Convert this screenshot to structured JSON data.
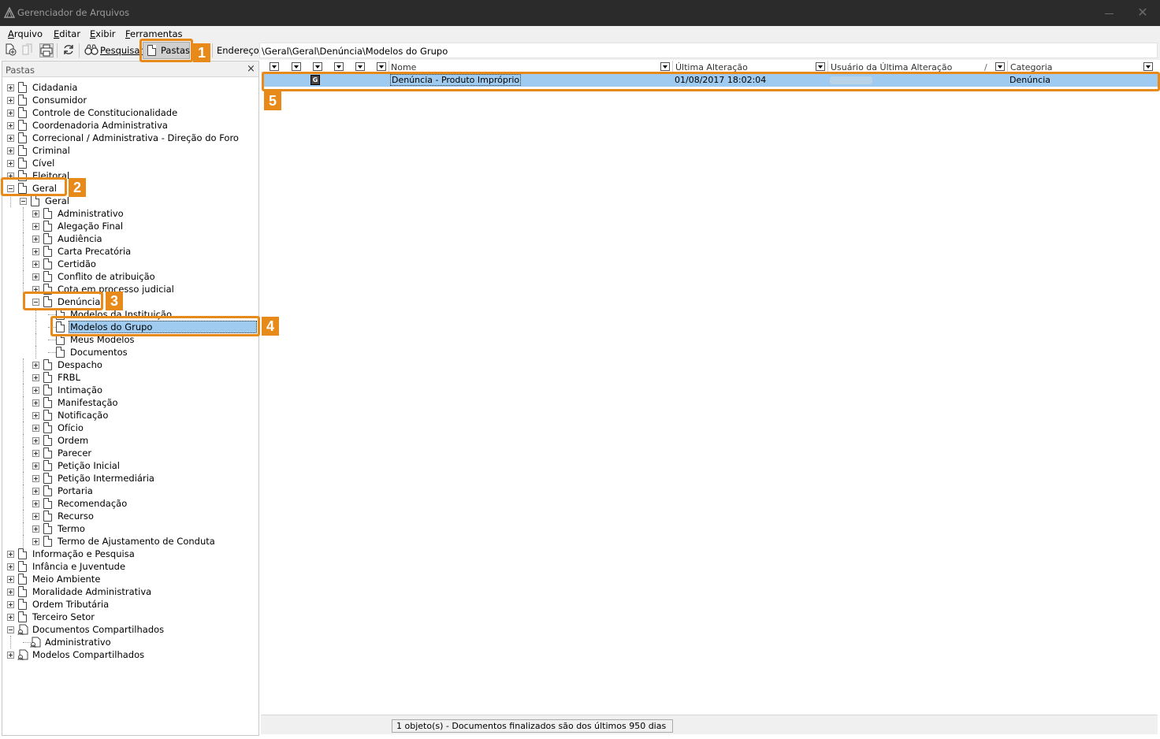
{
  "window": {
    "title": "Gerenciador de Arquivos",
    "close_glyph": "✕"
  },
  "menu": [
    "Arquivo",
    "Editar",
    "Exibir",
    "Ferramentas"
  ],
  "toolbar": {
    "search_label": "Pesquisar",
    "folders_label": "Pastas",
    "address_label": "Endereço",
    "address_value": "\\Geral\\Geral\\Denúncia\\Modelos do Grupo"
  },
  "left_pane": {
    "header": "Pastas",
    "close_glyph": "×",
    "tree": [
      {
        "label": "Cidadania",
        "level": 0,
        "expander": "plus"
      },
      {
        "label": "Consumidor",
        "level": 0,
        "expander": "plus"
      },
      {
        "label": "Controle de Constitucionalidade",
        "level": 0,
        "expander": "plus"
      },
      {
        "label": "Coordenadoria Administrativa",
        "level": 0,
        "expander": "plus"
      },
      {
        "label": "Correcional / Administrativa - Direção do Foro",
        "level": 0,
        "expander": "plus"
      },
      {
        "label": "Criminal",
        "level": 0,
        "expander": "plus"
      },
      {
        "label": "Cível",
        "level": 0,
        "expander": "plus"
      },
      {
        "label": "Eleitoral",
        "level": 0,
        "expander": "plus"
      },
      {
        "label": "Geral",
        "level": 0,
        "expander": "minus"
      },
      {
        "label": "Geral",
        "level": 1,
        "expander": "minus"
      },
      {
        "label": "Administrativo",
        "level": 2,
        "expander": "plus"
      },
      {
        "label": "Alegação Final",
        "level": 2,
        "expander": "plus"
      },
      {
        "label": "Audiência",
        "level": 2,
        "expander": "plus"
      },
      {
        "label": "Carta Precatória",
        "level": 2,
        "expander": "plus"
      },
      {
        "label": "Certidão",
        "level": 2,
        "expander": "plus"
      },
      {
        "label": "Conflito de atribuição",
        "level": 2,
        "expander": "plus"
      },
      {
        "label": "Cota em processo judicial",
        "level": 2,
        "expander": "plus"
      },
      {
        "label": "Denúncia",
        "level": 2,
        "expander": "minus"
      },
      {
        "label": "Modelos da Instituição",
        "level": 3,
        "expander": "none"
      },
      {
        "label": "Modelos do Grupo",
        "level": 3,
        "expander": "none",
        "selected": true
      },
      {
        "label": "Meus Modelos",
        "level": 3,
        "expander": "none"
      },
      {
        "label": "Documentos",
        "level": 3,
        "expander": "none"
      },
      {
        "label": "Despacho",
        "level": 2,
        "expander": "plus"
      },
      {
        "label": "FRBL",
        "level": 2,
        "expander": "plus"
      },
      {
        "label": "Intimação",
        "level": 2,
        "expander": "plus"
      },
      {
        "label": "Manifestação",
        "level": 2,
        "expander": "plus"
      },
      {
        "label": "Notificação",
        "level": 2,
        "expander": "plus"
      },
      {
        "label": "Ofício",
        "level": 2,
        "expander": "plus"
      },
      {
        "label": "Ordem",
        "level": 2,
        "expander": "plus"
      },
      {
        "label": "Parecer",
        "level": 2,
        "expander": "plus"
      },
      {
        "label": "Petição Inicial",
        "level": 2,
        "expander": "plus"
      },
      {
        "label": "Petição Intermediária",
        "level": 2,
        "expander": "plus"
      },
      {
        "label": "Portaria",
        "level": 2,
        "expander": "plus"
      },
      {
        "label": "Recomendação",
        "level": 2,
        "expander": "plus"
      },
      {
        "label": "Recurso",
        "level": 2,
        "expander": "plus"
      },
      {
        "label": "Termo",
        "level": 2,
        "expander": "plus"
      },
      {
        "label": "Termo de Ajustamento de Conduta",
        "level": 2,
        "expander": "plus"
      },
      {
        "label": "Informação e Pesquisa",
        "level": 0,
        "expander": "plus"
      },
      {
        "label": "Infância e Juventude",
        "level": 0,
        "expander": "plus"
      },
      {
        "label": "Meio Ambiente",
        "level": 0,
        "expander": "plus"
      },
      {
        "label": "Moralidade Administrativa",
        "level": 0,
        "expander": "plus"
      },
      {
        "label": "Ordem Tributária",
        "level": 0,
        "expander": "plus"
      },
      {
        "label": "Terceiro Setor",
        "level": 0,
        "expander": "plus"
      },
      {
        "label": "Documentos Compartilhados",
        "level": 0,
        "expander": "minus",
        "icon": "shared"
      },
      {
        "label": "Administrativo",
        "level": 1,
        "expander": "none",
        "icon": "shared"
      },
      {
        "label": "Modelos Compartilhados",
        "level": 0,
        "expander": "plus",
        "icon": "shared"
      }
    ]
  },
  "grid": {
    "columns": [
      {
        "label": "Nome"
      },
      {
        "label": "Última Alteração"
      },
      {
        "label": "Usuário da Última Alteração",
        "sort": "/"
      },
      {
        "label": "Categoria"
      }
    ],
    "rows": [
      {
        "type_icon": "G",
        "name": "Denúncia - Produto Impróprio",
        "modified": "01/08/2017 18:02:04",
        "user": "",
        "category": "Denúncia"
      }
    ]
  },
  "status": {
    "text": "1 objeto(s) - Documentos finalizados são dos últimos 950 dias"
  },
  "callouts": [
    "1",
    "2",
    "3",
    "4",
    "5"
  ],
  "colors": {
    "accent_orange": "#e88a1a",
    "selection_blue": "#9ecbef",
    "titlebar": "#2b2b2b"
  }
}
